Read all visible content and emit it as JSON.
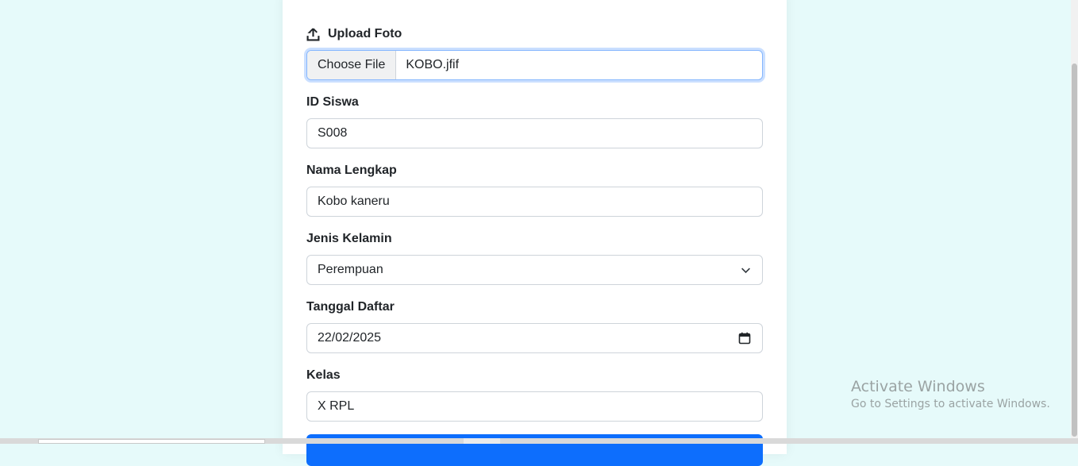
{
  "form": {
    "upload": {
      "label": "Upload Foto",
      "button": "Choose File",
      "filename": "KOBO.jfif"
    },
    "id_siswa": {
      "label": "ID Siswa",
      "value": "S008"
    },
    "nama": {
      "label": "Nama Lengkap",
      "value": "Kobo kaneru"
    },
    "jenis_kelamin": {
      "label": "Jenis Kelamin",
      "selected": "Perempuan"
    },
    "tanggal": {
      "label": "Tanggal Daftar",
      "value": "22/02/2025"
    },
    "kelas": {
      "label": "Kelas",
      "value": "X RPL"
    }
  },
  "watermark": {
    "title": "Activate Windows",
    "subtitle": "Go to Settings to activate Windows."
  },
  "colors": {
    "page_bg": "#e6fafa",
    "primary": "#0d6efd",
    "focus_border": "#86b7fe"
  }
}
